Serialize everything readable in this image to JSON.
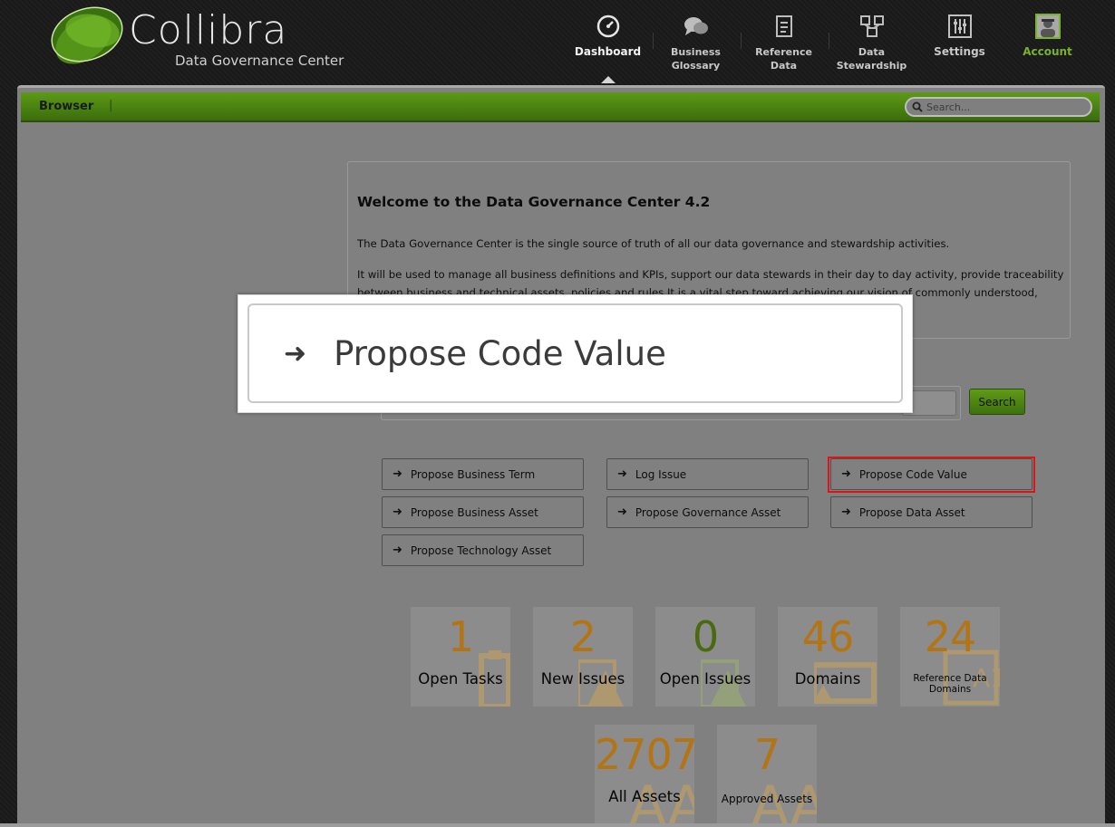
{
  "header": {
    "brand": "Collibra",
    "subtitle": "Data Governance Center",
    "nav": [
      {
        "label": "Dashboard",
        "icon": "dashboard-icon"
      },
      {
        "label": "Business\nGlossary",
        "icon": "speech-bubbles-icon"
      },
      {
        "label": "Reference\nData",
        "icon": "reference-data-icon"
      },
      {
        "label": "Data\nStewardship",
        "icon": "stewardship-icon"
      },
      {
        "label": "Settings",
        "icon": "sliders-icon"
      },
      {
        "label": "Account",
        "icon": "user-avatar-icon"
      }
    ]
  },
  "toolbar": {
    "browser_label": "Browser",
    "separator": "|",
    "search_placeholder": "Search..."
  },
  "welcome": {
    "title": "Welcome to the Data Governance Center 4.2",
    "paragraph1": "The Data Governance Center is the single source of truth of all our data governance and stewardship activities.",
    "paragraph2": "It will be used to manage all business definitions and KPIs, support our data stewards in their day to day activity, provide traceability between business and technical assets, policies and rules.It is a vital step toward achieving our vision of commonly understood,"
  },
  "search_button": "Search",
  "propose_buttons": [
    "Propose Business Term",
    "Log Issue",
    "Propose Code Value",
    "Propose Business Asset",
    "Propose Governance Asset",
    "Propose Data Asset",
    "Propose Technology Asset"
  ],
  "tiles": [
    {
      "value": "1",
      "label": "Open Tasks"
    },
    {
      "value": "2",
      "label": "New Issues"
    },
    {
      "value": "0",
      "label": "Open Issues"
    },
    {
      "value": "46",
      "label": "Domains"
    },
    {
      "value": "24",
      "label": "Reference Data Domains"
    },
    {
      "value": "2707",
      "label": "All Assets"
    },
    {
      "value": "7",
      "label": "Approved Assets"
    }
  ],
  "zoom_callout": {
    "label": "Propose Code Value"
  },
  "colors": {
    "accent_green": "#4e8a12",
    "tile_number": "#b37414",
    "highlight": "#e01414",
    "account_green": "#79b32b"
  }
}
